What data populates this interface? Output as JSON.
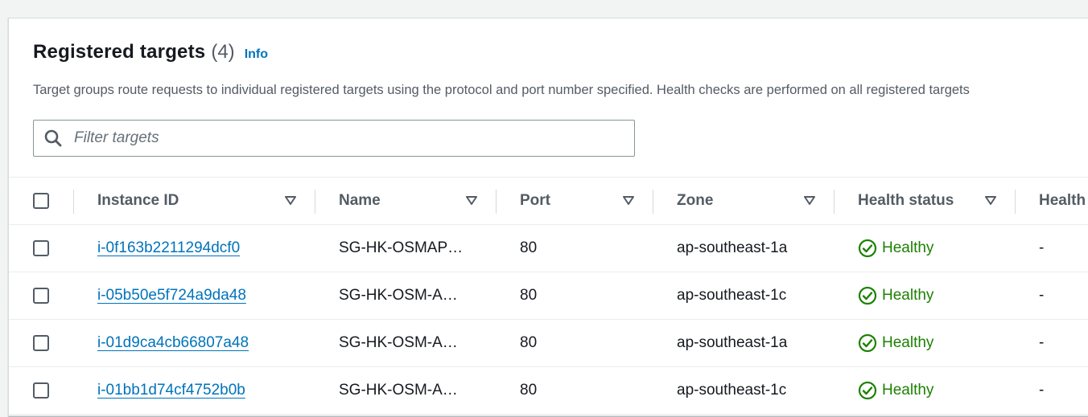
{
  "section": {
    "title": "Registered targets",
    "count": "(4)",
    "info_link": "Info",
    "description": "Target groups route requests to individual registered targets using the protocol and port number specified. Health checks are performed on all registered targets"
  },
  "filter": {
    "placeholder": "Filter targets",
    "value": ""
  },
  "table": {
    "columns": [
      {
        "label": "Instance ID"
      },
      {
        "label": "Name"
      },
      {
        "label": "Port"
      },
      {
        "label": "Zone"
      },
      {
        "label": "Health status"
      },
      {
        "label": "Health"
      }
    ],
    "rows": [
      {
        "instance_id": "i-0f163b2211294dcf0",
        "name": "SG-HK-OSMAP…",
        "port": "80",
        "zone": "ap-southeast-1a",
        "health_status": "Healthy",
        "health_details": "-"
      },
      {
        "instance_id": "i-05b50e5f724a9da48",
        "name": "SG-HK-OSM-A…",
        "port": "80",
        "zone": "ap-southeast-1c",
        "health_status": "Healthy",
        "health_details": "-"
      },
      {
        "instance_id": "i-01d9ca4cb66807a48",
        "name": "SG-HK-OSM-A…",
        "port": "80",
        "zone": "ap-southeast-1a",
        "health_status": "Healthy",
        "health_details": "-"
      },
      {
        "instance_id": "i-01bb1d74cf4752b0b",
        "name": "SG-HK-OSM-A…",
        "port": "80",
        "zone": "ap-southeast-1c",
        "health_status": "Healthy",
        "health_details": "-"
      }
    ]
  },
  "colors": {
    "link": "#0073bb",
    "healthy": "#1d8102",
    "header_text": "#545b64",
    "border": "#eaeded"
  }
}
